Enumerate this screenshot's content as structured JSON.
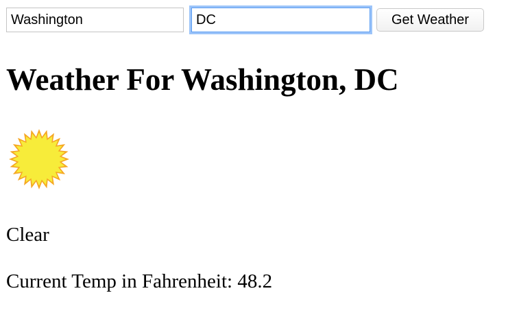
{
  "form": {
    "city_value": "Washington",
    "state_value": "DC",
    "submit_label": "Get Weather"
  },
  "weather": {
    "title_prefix": "Weather For ",
    "city": "Washington",
    "separator": ", ",
    "state": "DC",
    "icon": "sun-icon",
    "condition": "Clear",
    "temp_label": "Current Temp in Fahrenheit: ",
    "temp_value": "48.2"
  },
  "colors": {
    "sun_fill": "#f7ec3a",
    "sun_rays": "#f5a623",
    "focus_ring": "#5b9df2"
  }
}
